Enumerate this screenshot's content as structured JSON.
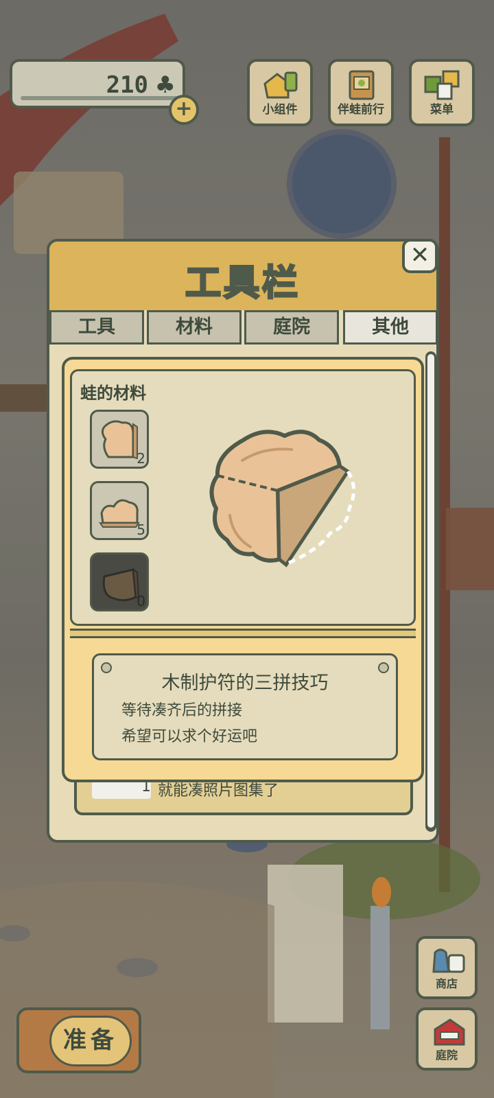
{
  "hud": {
    "clover_count": "210",
    "clover_icon": "clover-icon",
    "plus_label": "+"
  },
  "top_buttons": [
    {
      "label": "小组件",
      "icon": "widget-icon"
    },
    {
      "label": "伴蛙前行",
      "icon": "journey-book-icon"
    },
    {
      "label": "菜单",
      "icon": "menu-icon"
    }
  ],
  "panel": {
    "title": "工具栏",
    "close_label": "✕",
    "tabs": [
      {
        "label": "工具",
        "active": false
      },
      {
        "label": "材料",
        "active": false
      },
      {
        "label": "庭院",
        "active": false
      },
      {
        "label": "其他",
        "active": true
      }
    ],
    "peek_row": {
      "count": "1",
      "text": "就能凑照片图集了"
    }
  },
  "popup": {
    "section_title": "蛙的材料",
    "items": [
      {
        "count": "2",
        "icon": "wood-charm-piece-icon"
      },
      {
        "count": "5",
        "icon": "wood-charm-piece-icon"
      },
      {
        "count": "0",
        "icon": "wood-charm-piece-icon"
      }
    ],
    "preview_icon": "wooden-charm-preview-icon",
    "description": {
      "title": "木制护符的三拼技巧",
      "lines": [
        "等待凑齐后的拼接",
        "希望可以求个好运吧"
      ]
    }
  },
  "bottom": {
    "prepare_label": "准备",
    "side_buttons": [
      {
        "label": "商店",
        "icon": "shop-bag-icon"
      },
      {
        "label": "庭院",
        "icon": "garden-house-icon"
      }
    ]
  },
  "colors": {
    "outline": "#4f5a4a",
    "panel_header": "#dbb45c",
    "popup_bg": "#f6d994",
    "parchment": "#e5dcbd"
  }
}
